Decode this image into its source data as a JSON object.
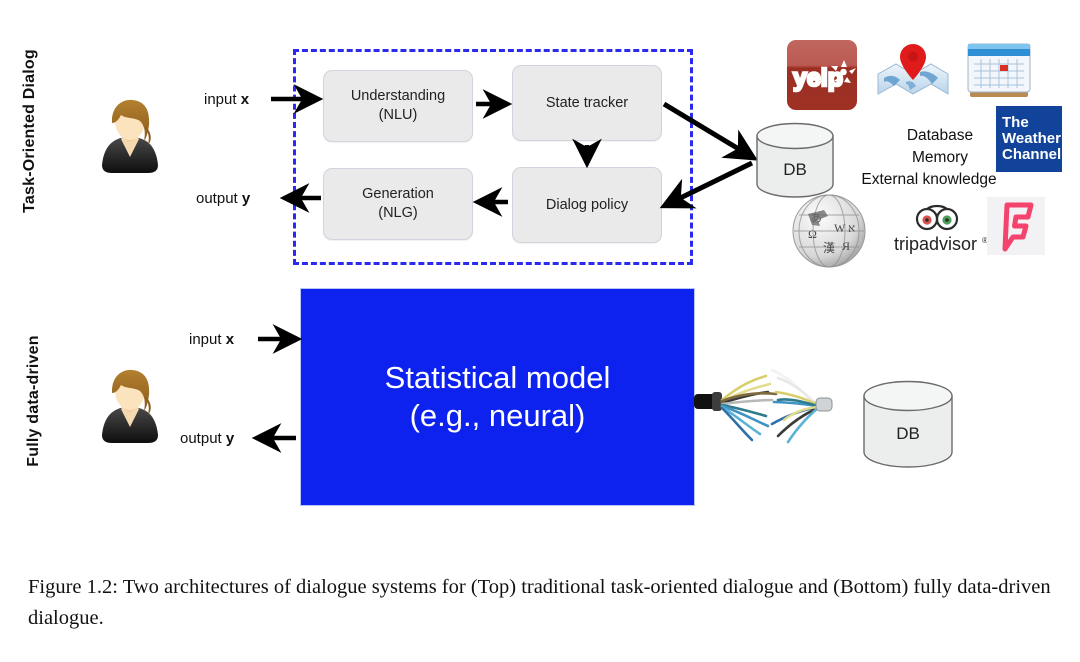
{
  "figure": {
    "caption": "Figure 1.2: Two architectures of dialogue systems for (Top) traditional task-oriented dialogue and (Bottom) fully data-driven dialogue."
  },
  "rows": {
    "top": {
      "label": "Task-Oriented Dialog"
    },
    "bottom": {
      "label": "Fully data-driven"
    }
  },
  "io": {
    "input_word": "input",
    "input_var": "x",
    "output_word": "output",
    "output_var": "y"
  },
  "pipeline": {
    "modules": [
      {
        "id": "nlu",
        "line1": "Understanding",
        "line2": "(NLU)"
      },
      {
        "id": "state-tracker",
        "line1": "State tracker",
        "line2": ""
      },
      {
        "id": "dialog-policy",
        "line1": "Dialog policy",
        "line2": ""
      },
      {
        "id": "nlg",
        "line1": "Generation",
        "line2": "(NLG)"
      }
    ]
  },
  "model": {
    "line1": "Statistical model",
    "line2": "(e.g., neural)"
  },
  "database": {
    "top_label": "DB",
    "bottom_label": "DB"
  },
  "knowledge": {
    "lines": [
      "Database",
      "Memory",
      "External knowledge"
    ],
    "logos": [
      {
        "name": "yelp-logo",
        "text": "yelp"
      },
      {
        "name": "map-logo",
        "text": ""
      },
      {
        "name": "calendar-logo",
        "text": ""
      },
      {
        "name": "weather-channel-logo",
        "line1": "The",
        "line2": "Weather",
        "line3": "Channel"
      },
      {
        "name": "wikipedia-logo",
        "text": ""
      },
      {
        "name": "tripadvisor-logo",
        "text": "tripadvisor"
      },
      {
        "name": "foursquare-logo",
        "text": ""
      }
    ]
  },
  "colors": {
    "dashed_border": "#2b2bf0",
    "model_fill": "#0d22ee",
    "module_fill": "#eaeaea",
    "yelp_red": "#9e3124",
    "weather_blue": "#12439a",
    "foursquare_pink": "#f4436c"
  }
}
